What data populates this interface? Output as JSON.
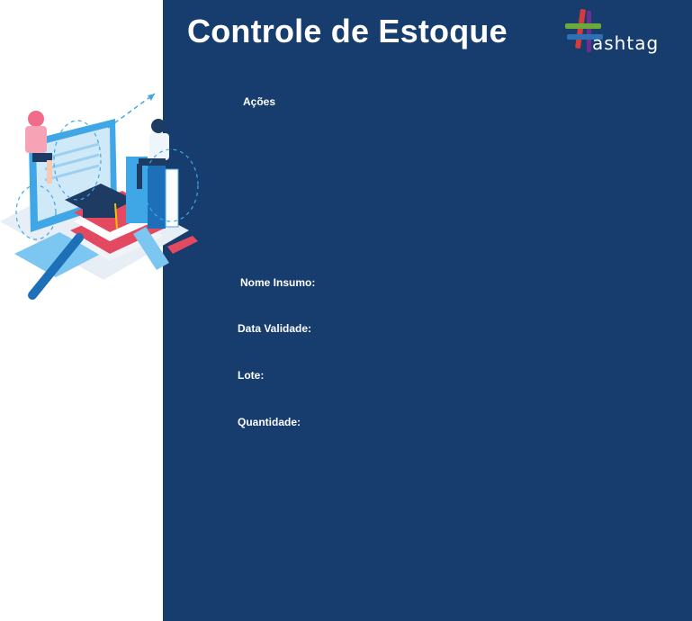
{
  "header": {
    "title": "Controle de Estoque",
    "logo_text": "ashtag"
  },
  "form": {
    "acoes_label": "Ações",
    "nome_insumo_label": "Nome Insumo:",
    "data_validade_label": "Data Validade:",
    "lote_label": "Lote:",
    "quantidade_label": "Quantidade:"
  },
  "colors": {
    "panel_background": "#173c6e",
    "text": "#ffffff",
    "logo_green": "#6aaa3a",
    "logo_purple": "#6b2f8f",
    "logo_red": "#d43b3b",
    "logo_blue": "#2f6fb5"
  },
  "icons": {
    "logo": "hashtag-logo-icon",
    "illustration": "education-illustration"
  }
}
